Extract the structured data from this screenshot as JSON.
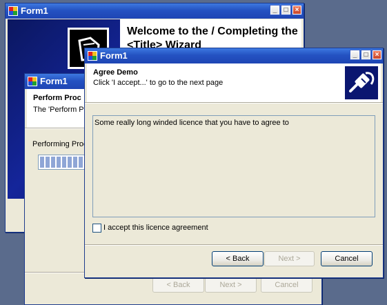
{
  "window_back": {
    "title": "Form1",
    "welcome_title": "Welcome to the / Completing the <Title> Wizard"
  },
  "window_middle": {
    "title": "Form1",
    "header_title": "Perform Proc",
    "header_sub": "The 'Perform Pr",
    "progress_label": "Performing Proc",
    "buttons": {
      "back": "< Back",
      "next": "Next >",
      "cancel": "Cancel"
    }
  },
  "window_front": {
    "title": "Form1",
    "header_title": "Agree Demo",
    "header_sub": "Click 'I accept...' to go to the next page",
    "licence_text": "Some really long winded licence that you have to agree to",
    "checkbox_label": "I accept this licence agreement",
    "checkbox_checked": false,
    "buttons": {
      "back": "< Back",
      "next": "Next >",
      "cancel": "Cancel"
    }
  },
  "title_buttons": [
    "minimize-icon",
    "maximize-icon",
    "close-icon"
  ],
  "colors": {
    "titlebar": "#2452c2",
    "wizard_sidebar": "#0c1a6e",
    "face": "#ece9d8"
  }
}
